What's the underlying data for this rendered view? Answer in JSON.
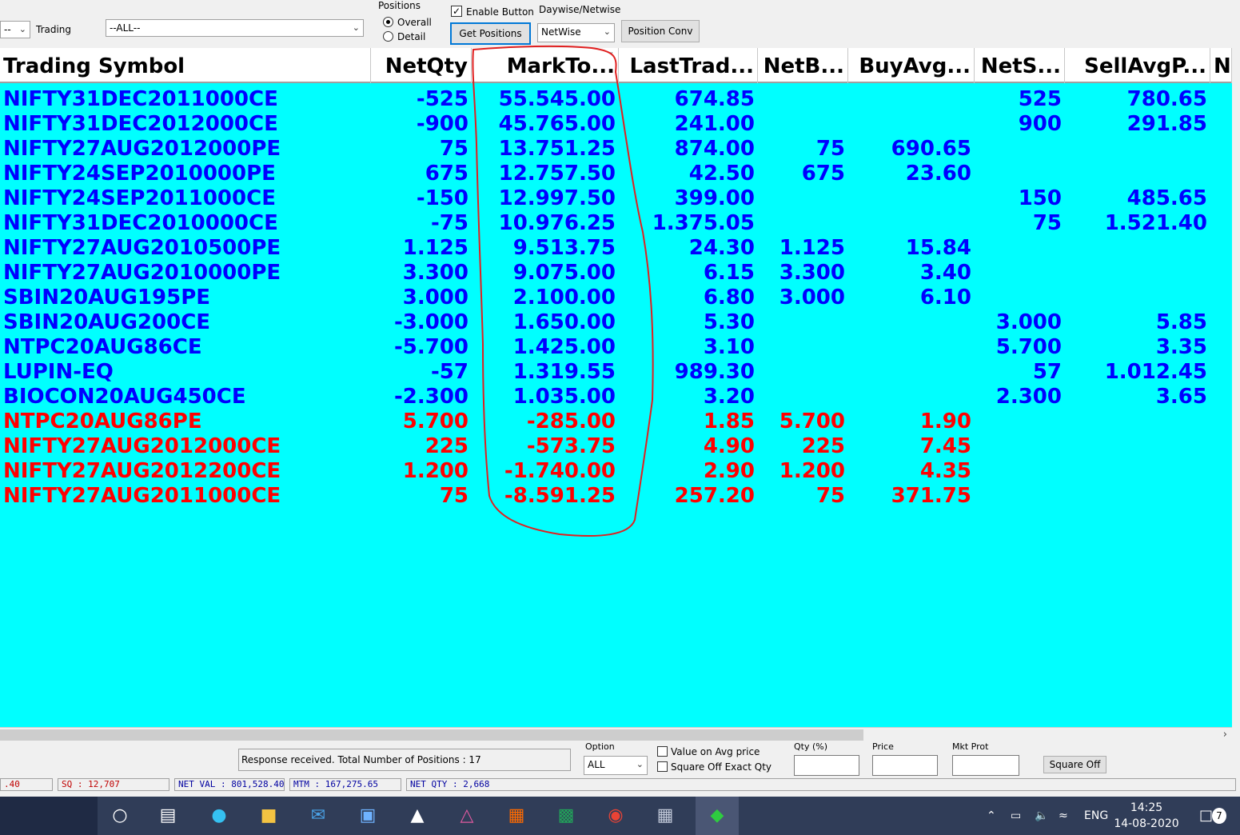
{
  "toolbar": {
    "left_combo": "--",
    "trading_label": "Trading",
    "trading_combo": "--ALL--",
    "positions_label": "Positions",
    "overall_label": "Overall",
    "detail_label": "Detail",
    "enable_button_label": "Enable Button",
    "get_positions_label": "Get Positions",
    "daywise_label": "Daywise/Netwise",
    "netwise_value": "NetWise",
    "position_conv_label": "Position Conv"
  },
  "columns": [
    "Trading Symbol",
    "NetQty",
    "MarkTo...",
    "LastTrad...",
    "NetB...",
    "BuyAvg...",
    "NetS...",
    "SellAvgP...",
    "N"
  ],
  "colors": {
    "profit": "#0000ff",
    "loss": "#ff0000",
    "grid_bg": "#00ffff",
    "annotation": "#e02020"
  },
  "rows": [
    {
      "symbol": "NIFTY31DEC2011000CE",
      "netqty": "-525",
      "mtm": "55.545.00",
      "ltp": "674.85",
      "netb": "",
      "buyavg": "",
      "nets": "525",
      "sellavg": "780.65",
      "color": "#0000ff"
    },
    {
      "symbol": "NIFTY31DEC2012000CE",
      "netqty": "-900",
      "mtm": "45.765.00",
      "ltp": "241.00",
      "netb": "",
      "buyavg": "",
      "nets": "900",
      "sellavg": "291.85",
      "color": "#0000ff"
    },
    {
      "symbol": "NIFTY27AUG2012000PE",
      "netqty": "75",
      "mtm": "13.751.25",
      "ltp": "874.00",
      "netb": "75",
      "buyavg": "690.65",
      "nets": "",
      "sellavg": "",
      "color": "#0000ff"
    },
    {
      "symbol": "NIFTY24SEP2010000PE",
      "netqty": "675",
      "mtm": "12.757.50",
      "ltp": "42.50",
      "netb": "675",
      "buyavg": "23.60",
      "nets": "",
      "sellavg": "",
      "color": "#0000ff"
    },
    {
      "symbol": "NIFTY24SEP2011000CE",
      "netqty": "-150",
      "mtm": "12.997.50",
      "ltp": "399.00",
      "netb": "",
      "buyavg": "",
      "nets": "150",
      "sellavg": "485.65",
      "color": "#0000ff"
    },
    {
      "symbol": "NIFTY31DEC2010000CE",
      "netqty": "-75",
      "mtm": "10.976.25",
      "ltp": "1.375.05",
      "netb": "",
      "buyavg": "",
      "nets": "75",
      "sellavg": "1.521.40",
      "color": "#0000ff"
    },
    {
      "symbol": "NIFTY27AUG2010500PE",
      "netqty": "1.125",
      "mtm": "9.513.75",
      "ltp": "24.30",
      "netb": "1.125",
      "buyavg": "15.84",
      "nets": "",
      "sellavg": "",
      "color": "#0000ff"
    },
    {
      "symbol": "NIFTY27AUG2010000PE",
      "netqty": "3.300",
      "mtm": "9.075.00",
      "ltp": "6.15",
      "netb": "3.300",
      "buyavg": "3.40",
      "nets": "",
      "sellavg": "",
      "color": "#0000ff"
    },
    {
      "symbol": "SBIN20AUG195PE",
      "netqty": "3.000",
      "mtm": "2.100.00",
      "ltp": "6.80",
      "netb": "3.000",
      "buyavg": "6.10",
      "nets": "",
      "sellavg": "",
      "color": "#0000ff"
    },
    {
      "symbol": "SBIN20AUG200CE",
      "netqty": "-3.000",
      "mtm": "1.650.00",
      "ltp": "5.30",
      "netb": "",
      "buyavg": "",
      "nets": "3.000",
      "sellavg": "5.85",
      "color": "#0000ff"
    },
    {
      "symbol": "NTPC20AUG86CE",
      "netqty": "-5.700",
      "mtm": "1.425.00",
      "ltp": "3.10",
      "netb": "",
      "buyavg": "",
      "nets": "5.700",
      "sellavg": "3.35",
      "color": "#0000ff"
    },
    {
      "symbol": "LUPIN-EQ",
      "netqty": "-57",
      "mtm": "1.319.55",
      "ltp": "989.30",
      "netb": "",
      "buyavg": "",
      "nets": "57",
      "sellavg": "1.012.45",
      "color": "#0000ff"
    },
    {
      "symbol": "BIOCON20AUG450CE",
      "netqty": "-2.300",
      "mtm": "1.035.00",
      "ltp": "3.20",
      "netb": "",
      "buyavg": "",
      "nets": "2.300",
      "sellavg": "3.65",
      "color": "#0000ff"
    },
    {
      "symbol": "NTPC20AUG86PE",
      "netqty": "5.700",
      "mtm": "-285.00",
      "ltp": "1.85",
      "netb": "5.700",
      "buyavg": "1.90",
      "nets": "",
      "sellavg": "",
      "color": "#ff0000"
    },
    {
      "symbol": "NIFTY27AUG2012000CE",
      "netqty": "225",
      "mtm": "-573.75",
      "ltp": "4.90",
      "netb": "225",
      "buyavg": "7.45",
      "nets": "",
      "sellavg": "",
      "color": "#ff0000"
    },
    {
      "symbol": "NIFTY27AUG2012200CE",
      "netqty": "1.200",
      "mtm": "-1.740.00",
      "ltp": "2.90",
      "netb": "1.200",
      "buyavg": "4.35",
      "nets": "",
      "sellavg": "",
      "color": "#ff0000"
    },
    {
      "symbol": "NIFTY27AUG2011000CE",
      "netqty": "75",
      "mtm": "-8.591.25",
      "ltp": "257.20",
      "netb": "75",
      "buyavg": "371.75",
      "nets": "",
      "sellavg": "",
      "color": "#ff0000"
    }
  ],
  "bottom": {
    "status_text": "Response received.  Total Number of Positions : 17",
    "option_label": "Option",
    "option_value": "ALL",
    "value_on_avg_label": "Value on Avg  price",
    "square_off_exact_label": "Square Off Exact Qty",
    "qty_label": "Qty (%)",
    "price_label": "Price",
    "mkt_prot_label": "Mkt Prot",
    "square_off_button": "Square Off"
  },
  "statusbar": {
    "first": ".40",
    "sq": "SQ : 12,707",
    "net_val": "NET VAL : 801,528.40",
    "mtm": "MTM : 167,275.65",
    "net_qty": "NET QTY : 2,668"
  },
  "taskbar": {
    "icons": [
      "start-icon",
      "task-view-icon",
      "edge-icon",
      "file-explorer-icon",
      "mail-icon",
      "laptop-app-icon",
      "trading-app-icon",
      "affinity-icon",
      "office-icon",
      "excel-icon",
      "chrome-icon",
      "calculator-icon",
      "terminal-app-icon"
    ],
    "language": "ENG",
    "time": "14:25",
    "date": "14-08-2020",
    "notifications": "7"
  }
}
